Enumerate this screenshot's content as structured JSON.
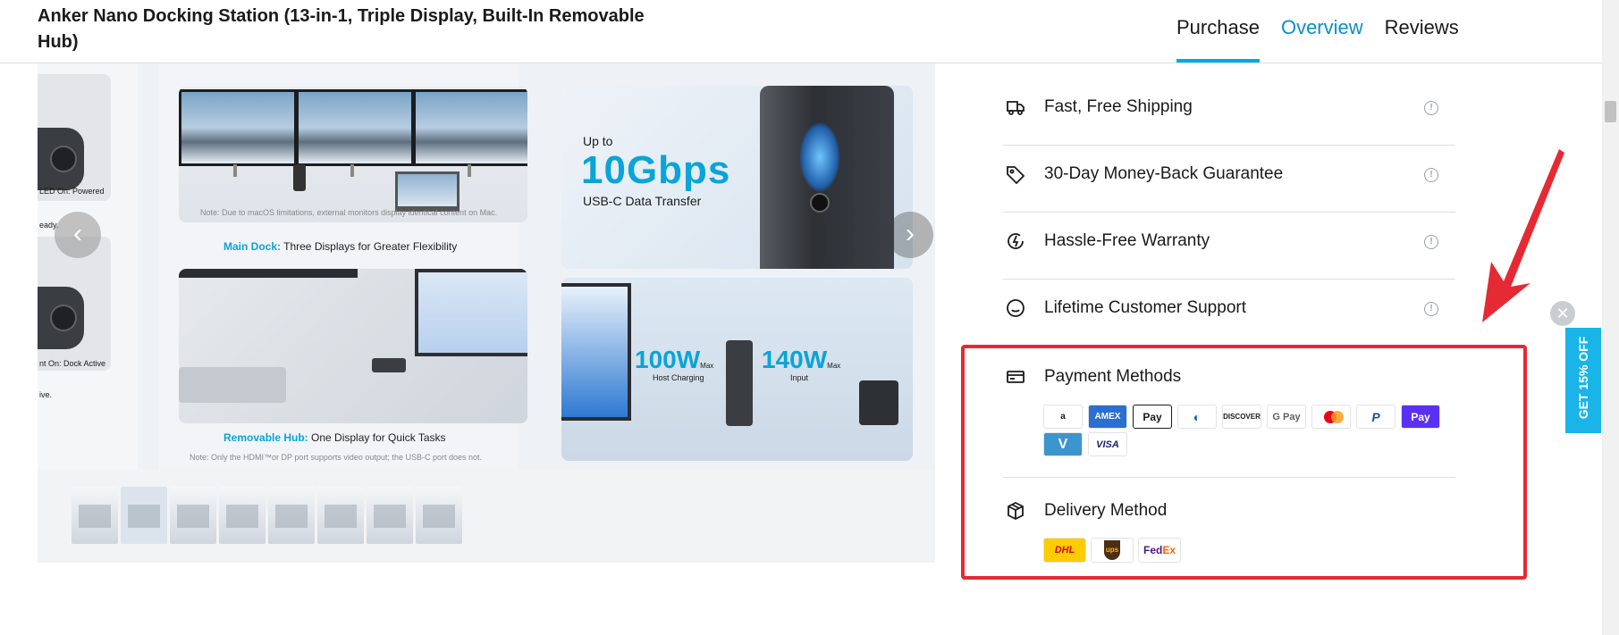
{
  "header": {
    "title": "Anker Nano Docking Station (13-in-1, Triple Display, Built-In Removable Hub)",
    "tabs": [
      {
        "label": "Purchase"
      },
      {
        "label": "Overview"
      },
      {
        "label": "Reviews"
      }
    ]
  },
  "gallery": {
    "left_caption_top": "LED On: Powered",
    "left_caption_top2": "eady.",
    "left_caption_bottom": "nt On: Dock Active",
    "left_caption_bottom2": "ive.",
    "main_dock": {
      "note": "Note: Due to macOS limitations, external monitors display identical content on Mac.",
      "caption_highlight": "Main Dock:",
      "caption_text": " Three Displays for Greater Flexibility"
    },
    "removable_hub": {
      "caption_highlight": "Removable Hub:",
      "caption_text": " One Display for Quick Tasks",
      "note": "Note: Only the HDMI™or DP port supports video output; the USB-C port does not."
    },
    "speed": {
      "up_to": "Up to",
      "value": "10Gbps",
      "subtitle": "USB-C Data Transfer"
    },
    "charging": {
      "host_watt": "100W",
      "host_max": "Max",
      "host_label": "Host Charging",
      "input_watt": "140W",
      "input_max": "Max",
      "input_label": "Input"
    },
    "prev_glyph": "‹",
    "next_glyph": "›"
  },
  "benefits": [
    {
      "label": "Fast, Free Shipping",
      "icon": "truck-icon"
    },
    {
      "label": "30-Day Money-Back Guarantee",
      "icon": "tag-icon"
    },
    {
      "label": "Hassle-Free Warranty",
      "icon": "warranty-icon"
    },
    {
      "label": "Lifetime Customer Support",
      "icon": "support-icon"
    }
  ],
  "payment": {
    "title": "Payment Methods",
    "methods": {
      "amazon": "a",
      "amex": "AMEX",
      "applepay": " Pay",
      "diners": "◐",
      "discover": "DISCOVER",
      "gpay": "G Pay",
      "paypal": "P",
      "shoppay": "Pay",
      "venmo": "V",
      "visa": "VISA"
    }
  },
  "delivery": {
    "title": "Delivery Method",
    "carriers": {
      "dhl": "DHL",
      "ups": "ups",
      "fedex_fe": "Fed",
      "fedex_ex": "Ex"
    }
  },
  "promo": {
    "label": "GET 15% OFF",
    "close": "✕"
  },
  "colors": {
    "accent": "#00a9e0",
    "highlight_frame": "#e52a33",
    "promo_bg": "#19b4e8"
  }
}
